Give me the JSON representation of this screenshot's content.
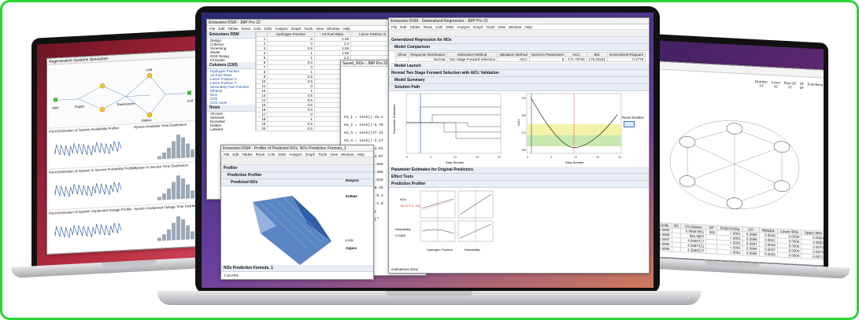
{
  "colors": {
    "frame_border": "#25d630",
    "left_wallpaper": "#8a1f2e",
    "right_wallpaper": "#6a2a6e",
    "center_wallpaper": "#4a3a8c"
  },
  "left_laptop": {
    "report_title": "Regenerative Systems Simulation",
    "diagram_labels": [
      "Start",
      "Engine",
      "Transmission",
      "Battery",
      "Cold",
      "End"
    ],
    "plots": [
      {
        "title": "Point Estimation of System Availability Profiler",
        "side_title": "System Available Time Distribution"
      },
      {
        "title": "Point Estimation of System In Service Probability Profiler",
        "side_title": "System In Service Time Distribution"
      },
      {
        "title": "Point Estimation of System Unplanned Outage Profiler",
        "side_title": "System Unplanned Outage Time Distribution"
      }
    ]
  },
  "data_table": {
    "title": "Emissions RSM - JMP Pro 22",
    "menu": [
      "File",
      "Edit",
      "Tables",
      "Rows",
      "Cols",
      "DOE",
      "Analyze",
      "Graph",
      "Tools",
      "View",
      "Window",
      "Help"
    ],
    "panel_title": "Emissions RSM",
    "panel_items": [
      "Design",
      "Criterion",
      "Screening",
      "Model",
      "DOE Dialog",
      "Fit Model"
    ],
    "columns_header": "Columns (13/0)",
    "columns": [
      "Hydrogen Fraction",
      "Air:Fuel Ratio",
      "Lance Position X",
      "Lance Position Y",
      "Secondary Fuel Fraction",
      "Ethanol",
      "NOx",
      "CO2",
      "CO2 Lacer"
    ],
    "rows_header": "Rows",
    "rows_items": [
      "All rows",
      "Selected",
      "Excluded",
      "Hidden",
      "Labeled"
    ],
    "headers": [
      "",
      "Hydrogen Fraction",
      "AIr:Fuel Ratio",
      "Lance Position X"
    ],
    "rows": [
      [
        "1",
        "0",
        "1.05",
        ""
      ],
      [
        "2",
        "0",
        "1.2",
        ""
      ],
      [
        "3",
        "0.5",
        "1.05",
        ""
      ],
      [
        "4",
        "1",
        "1.05",
        ""
      ],
      [
        "5",
        "1",
        "1.2",
        ""
      ],
      [
        "6",
        "0.5",
        "1.175",
        ""
      ],
      [
        "7",
        "0",
        "1.175",
        ""
      ],
      [
        "8",
        "1",
        "1.175",
        ""
      ],
      [
        "9",
        "0.5",
        "1.05",
        ""
      ],
      [
        "10",
        "0.5",
        "1.2",
        ""
      ],
      [
        "11",
        "0",
        "1.05",
        ""
      ],
      [
        "12",
        "1",
        "1.175",
        ""
      ],
      [
        "13",
        "0.5",
        "1.175",
        ""
      ],
      [
        "14",
        "0.5",
        "1.2",
        ""
      ],
      [
        "15",
        "0.5",
        "1.175",
        ""
      ],
      [
        "16",
        "0.5",
        "1.175",
        ""
      ],
      [
        "17",
        "0",
        "1.175",
        ""
      ],
      [
        "18",
        "1",
        "1.175",
        ""
      ],
      [
        "19",
        "0.5",
        "1.175",
        ""
      ],
      [
        "20",
        "0.5",
        "1.175",
        ""
      ]
    ]
  },
  "formula_window": {
    "title": "Saved_NOx - JMP Pro 22",
    "lines": [
      "H1_1 = tanh((-15.2",
      "H1_2 = tanh((-5.79",
      "H1_3 = tanh((37.31",
      "H1_4 = tanh((-2.27",
      "H1_5 = tanh((-1.61",
      "H1_6 = tanh((-4.07",
      "H1_7 = tanh((2.666",
      "H1_8 = tanh((2.466",
      "H1_9 = tanh((1.026",
      "H1_10 = tanh((0.46",
      "H1_11 = tanh((-0.3",
      "H1_12 = tanh((-1.0",
      "outdata[\"Predic",
      "return outdata[\""
    ]
  },
  "profiler_window": {
    "title": "Emissions RSM - Profiler of Predicted NOx, NOx Prediction Formula_1",
    "menu": [
      "File",
      "Edit",
      "Tables",
      "Rows",
      "Cols",
      "DOE",
      "Analyze",
      "Graph",
      "Tools",
      "View",
      "Window",
      "Help"
    ],
    "profiler_header": "Profiler",
    "prediction_profiler": "Prediction Profiler",
    "predicted_nox": "Predicted NOx",
    "response_label": "Respon",
    "indep_label": "Indepe",
    "lock_label": "Lock",
    "appear_label": "Appea",
    "formula_footer": "NOx Prediction Formula_1",
    "status": "7.23 FPS"
  },
  "regression_window": {
    "title": "Emissions RSM - Generalized Regression - JMP Pro 22",
    "menu": [
      "File",
      "Edit",
      "Tables",
      "Rows",
      "Cols",
      "DOE",
      "Analyze",
      "Graph",
      "Tools",
      "View",
      "Window",
      "Help"
    ],
    "main_header": "Generalized Regression for NOx",
    "model_comparison": "Model Comparison",
    "comparison_headers": [
      "Show",
      "Response Distribution",
      "Estimation Method",
      "Validation Method",
      "Nonzero Parameters",
      "AICc",
      "BIC",
      "Generalized RSquare"
    ],
    "comparison_row": [
      "",
      "Normal",
      "Two Stage Forward Selection",
      "AICc",
      "5",
      "171.78726",
      "175.33231",
      "0.2778"
    ],
    "model_launch": "Model Launch",
    "selection_header": "Normal Two Stage Forward Selection with AICc Validation",
    "model_summary": "Model Summary",
    "solution_path": "Solution Path",
    "reset_solution": "Reset Solution",
    "left_ylabel": "Parameter Estimates",
    "left_xlabel": "Step Number",
    "left_xticks": [
      "0",
      "5",
      "10",
      "15",
      "20"
    ],
    "right_ylabel": "AICc",
    "right_xlabel": "Step Number",
    "right_xticks": [
      "0",
      "5",
      "10",
      "15",
      "20"
    ],
    "right_yticks": [
      "190",
      "180",
      "170",
      "160"
    ],
    "param_estimates": "Parameter Estimates for Original Predictors",
    "effect_tests": "Effect Tests",
    "prediction_profiler": "Prediction Profiler",
    "nox_label": "NOx",
    "nox_value": "182 [171.8, 191]",
    "desirability": "Desirability",
    "desir_value": "0.91828",
    "x_labels": [
      "Hydrogen Fraction",
      "Desirability"
    ],
    "status": "evaluations done"
  },
  "right_laptop": {
    "stats_headers": [
      "Number",
      "Level",
      "Row Of",
      "Of",
      "Functions"
    ],
    "stats_values": [
      "14",
      "42",
      "17",
      "Of",
      ""
    ],
    "table_headers": [
      "",
      "R2 Grids",
      "R2",
      "Ch.Square",
      "DF",
      "Prob>ChiSq",
      "CFI",
      "RMSEA",
      "Lower 90%",
      "Upper 90%"
    ],
    "table_rows": [
      [
        "1",
        "0.9999",
        "",
        "0.96667851",
        "993",
        "<.0001",
        "0.9999",
        "0.0046",
        "0.0000",
        "0.0094"
      ],
      [
        "2",
        "0.9998",
        "",
        "683.5807",
        "",
        "<.0001",
        "0.9998",
        "0.0041",
        "0.0000",
        "0.0082"
      ],
      [
        "3",
        "0.9997",
        "",
        "4.6665717",
        "",
        "<.0001",
        "0.9997",
        "0.0039",
        "0.0000",
        "0.0079"
      ],
      [
        "4",
        "0.9996",
        "",
        "4.5687421",
        "",
        "<.0001",
        "0.9996",
        "0.0037",
        "0.0000",
        "0.0075"
      ],
      [
        "5",
        "0.9995",
        "",
        "4.3568227",
        "",
        "<.0001",
        "0.9995",
        "0.0035",
        "0.0000",
        "0.0071"
      ]
    ]
  }
}
